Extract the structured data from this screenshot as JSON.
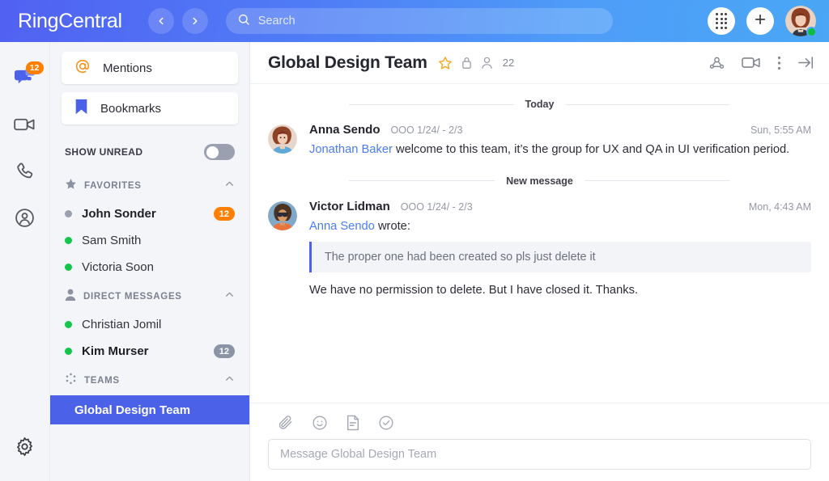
{
  "app": {
    "brand": "RingCentral"
  },
  "colors": {
    "header_gradient_start": "#5161f2",
    "header_gradient_end": "#4aa7f5",
    "accent_blue": "#4b62e8",
    "mention_blue": "#4b7bf5",
    "badge_orange": "#ff8000",
    "presence_green": "#13c54a",
    "sidebar_bg": "#f4f5f9",
    "star_orange": "#f5a623"
  },
  "topbar": {
    "back_icon": "chevron-left-icon",
    "forward_icon": "chevron-right-icon",
    "search": {
      "icon": "search-icon",
      "placeholder": "Search",
      "value": ""
    },
    "dialpad_icon": "dialpad-icon",
    "add_icon": "plus-icon",
    "avatar_icon": "user-avatar",
    "presence_status": "available"
  },
  "rail": {
    "items": [
      {
        "icon": "message-bubbles-icon",
        "label": "Message",
        "active": true,
        "badge": "12"
      },
      {
        "icon": "video-camera-icon",
        "label": "Video",
        "active": false,
        "badge": ""
      },
      {
        "icon": "phone-icon",
        "label": "Phone",
        "active": false,
        "badge": ""
      },
      {
        "icon": "contacts-icon",
        "label": "Contacts",
        "active": false,
        "badge": ""
      }
    ],
    "settings": {
      "icon": "gear-icon",
      "label": "Settings"
    }
  },
  "sidebar": {
    "cards": [
      {
        "icon": "at-sign-icon",
        "label": "Mentions"
      },
      {
        "icon": "bookmark-flag-icon",
        "label": "Bookmarks"
      }
    ],
    "show_unread": {
      "label": "SHOW UNREAD",
      "enabled": false
    },
    "sections": [
      {
        "icon": "star-icon",
        "title": "FAVORITES",
        "chevron": "chevron-up-icon",
        "items": [
          {
            "name": "John Sonder",
            "presence": "gray",
            "badge": "12",
            "badge_style": "orange",
            "unread": true
          },
          {
            "name": "Sam Smith",
            "presence": "green",
            "badge": "",
            "badge_style": "",
            "unread": false
          },
          {
            "name": "Victoria Soon",
            "presence": "green",
            "badge": "",
            "badge_style": "",
            "unread": false
          }
        ]
      },
      {
        "icon": "person-icon",
        "title": "DIRECT MESSAGES",
        "chevron": "chevron-up-icon",
        "items": [
          {
            "name": "Christian Jomil",
            "presence": "green",
            "badge": "",
            "badge_style": "",
            "unread": false
          },
          {
            "name": "Kim Murser",
            "presence": "green",
            "badge": "12",
            "badge_style": "gray",
            "unread": true
          }
        ]
      },
      {
        "icon": "teams-dots-icon",
        "title": "TEAMS",
        "chevron": "chevron-up-icon",
        "items": [
          {
            "name": "Global Design Team",
            "presence": "",
            "badge": "",
            "badge_style": "",
            "unread": false,
            "selected": true
          }
        ]
      }
    ]
  },
  "main": {
    "header": {
      "title": "Global Design Team",
      "star_icon": "star-outline-icon",
      "lock_icon": "lock-icon",
      "members_icon": "person-icon",
      "member_count": "22",
      "actions": [
        {
          "icon": "share-conference-icon",
          "label": "Conference"
        },
        {
          "icon": "video-camera-icon",
          "label": "Video call"
        },
        {
          "icon": "more-vertical-icon",
          "label": "More"
        },
        {
          "icon": "collapse-right-icon",
          "label": "Collapse"
        }
      ]
    },
    "dividers": {
      "today": "Today",
      "new_message": "New message"
    },
    "messages": [
      {
        "avatar": "anna-avatar",
        "author": "Anna Sendo",
        "status": "OOO 1/24/ - 2/3",
        "time": "Sun, 5:55 AM",
        "mention": "Jonathan Baker",
        "text": " welcome to this team, it’s the group for UX and QA in UI verification period."
      },
      {
        "avatar": "victor-avatar",
        "author": "Victor Lidman",
        "status": "OOO 1/24/ - 2/3",
        "time": "Mon, 4:43 AM",
        "quote_author": "Anna Sendo",
        "quote_prefix": " wrote:",
        "quote_text": "The proper one had been created so pls just delete it",
        "reply": "We have no permission to delete. But I have closed it. Thanks."
      }
    ],
    "composer": {
      "tools": [
        {
          "icon": "paperclip-icon",
          "label": "Attach file"
        },
        {
          "icon": "emoji-smiley-icon",
          "label": "Emoji"
        },
        {
          "icon": "note-icon",
          "label": "Note"
        },
        {
          "icon": "task-check-icon",
          "label": "Task"
        }
      ],
      "placeholder": "Message Global Design Team",
      "value": ""
    }
  }
}
